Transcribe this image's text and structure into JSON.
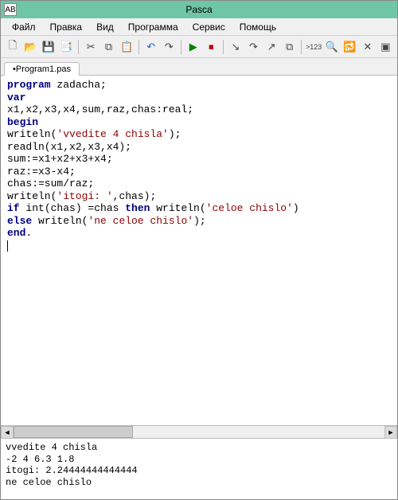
{
  "window": {
    "title": "Pasca",
    "app_icon_label": "AB"
  },
  "menu": {
    "file": "Файл",
    "edit": "Правка",
    "view": "Вид",
    "program": "Программа",
    "service": "Сервис",
    "help": "Помощь"
  },
  "toolbar": {
    "new": "🗋",
    "open": "📂",
    "save": "💾",
    "saveall": "📑",
    "cut": "✂",
    "copy": "⧉",
    "paste": "📋",
    "undo": "↶",
    "redo": "↷",
    "run": "▶",
    "stop": "⏹",
    "stepinto": "↘",
    "stepover": "↷",
    "stepout": "↗",
    "window": "⧉",
    "goto": ">123",
    "find": "🔍",
    "replace": "🔂",
    "close": "✕",
    "toggle": "▣"
  },
  "tab": {
    "name": "•Program1.pas"
  },
  "code": {
    "l1_kw": "program",
    "l1_rest": " zadacha;",
    "l2_kw": "var",
    "l3": "x1,x2,x3,x4,sum,raz,chas:real;",
    "l4_kw": "begin",
    "l5a": "writeln(",
    "l5s": "'vvedite 4 chisla'",
    "l5b": ");",
    "l6": "readln(x1,x2,x3,x4);",
    "l7": "sum:=x1+x2+x3+x4;",
    "l8": "raz:=x3-x4;",
    "l9": "chas:=sum/raz;",
    "l10a": "writeln(",
    "l10s": "'itogi: '",
    "l10b": ",chas);",
    "l11_if": "if",
    "l11_rest": " int(chas) =chas ",
    "l11_then": "then",
    "l11_w": " writeln(",
    "l11_s": "'celoe chislo'",
    "l11_e": ")",
    "l12_else": "else",
    "l12_w": " writeln(",
    "l12_s": "'ne celoe chislo'",
    "l12_e": ");",
    "l13_kw": "end",
    "l13_dot": "."
  },
  "console": {
    "line1": "vvedite 4 chisla",
    "line2": "-2 4 6.3 1.8",
    "line3": "itogi: 2.24444444444444",
    "line4": "ne celoe chislo"
  }
}
